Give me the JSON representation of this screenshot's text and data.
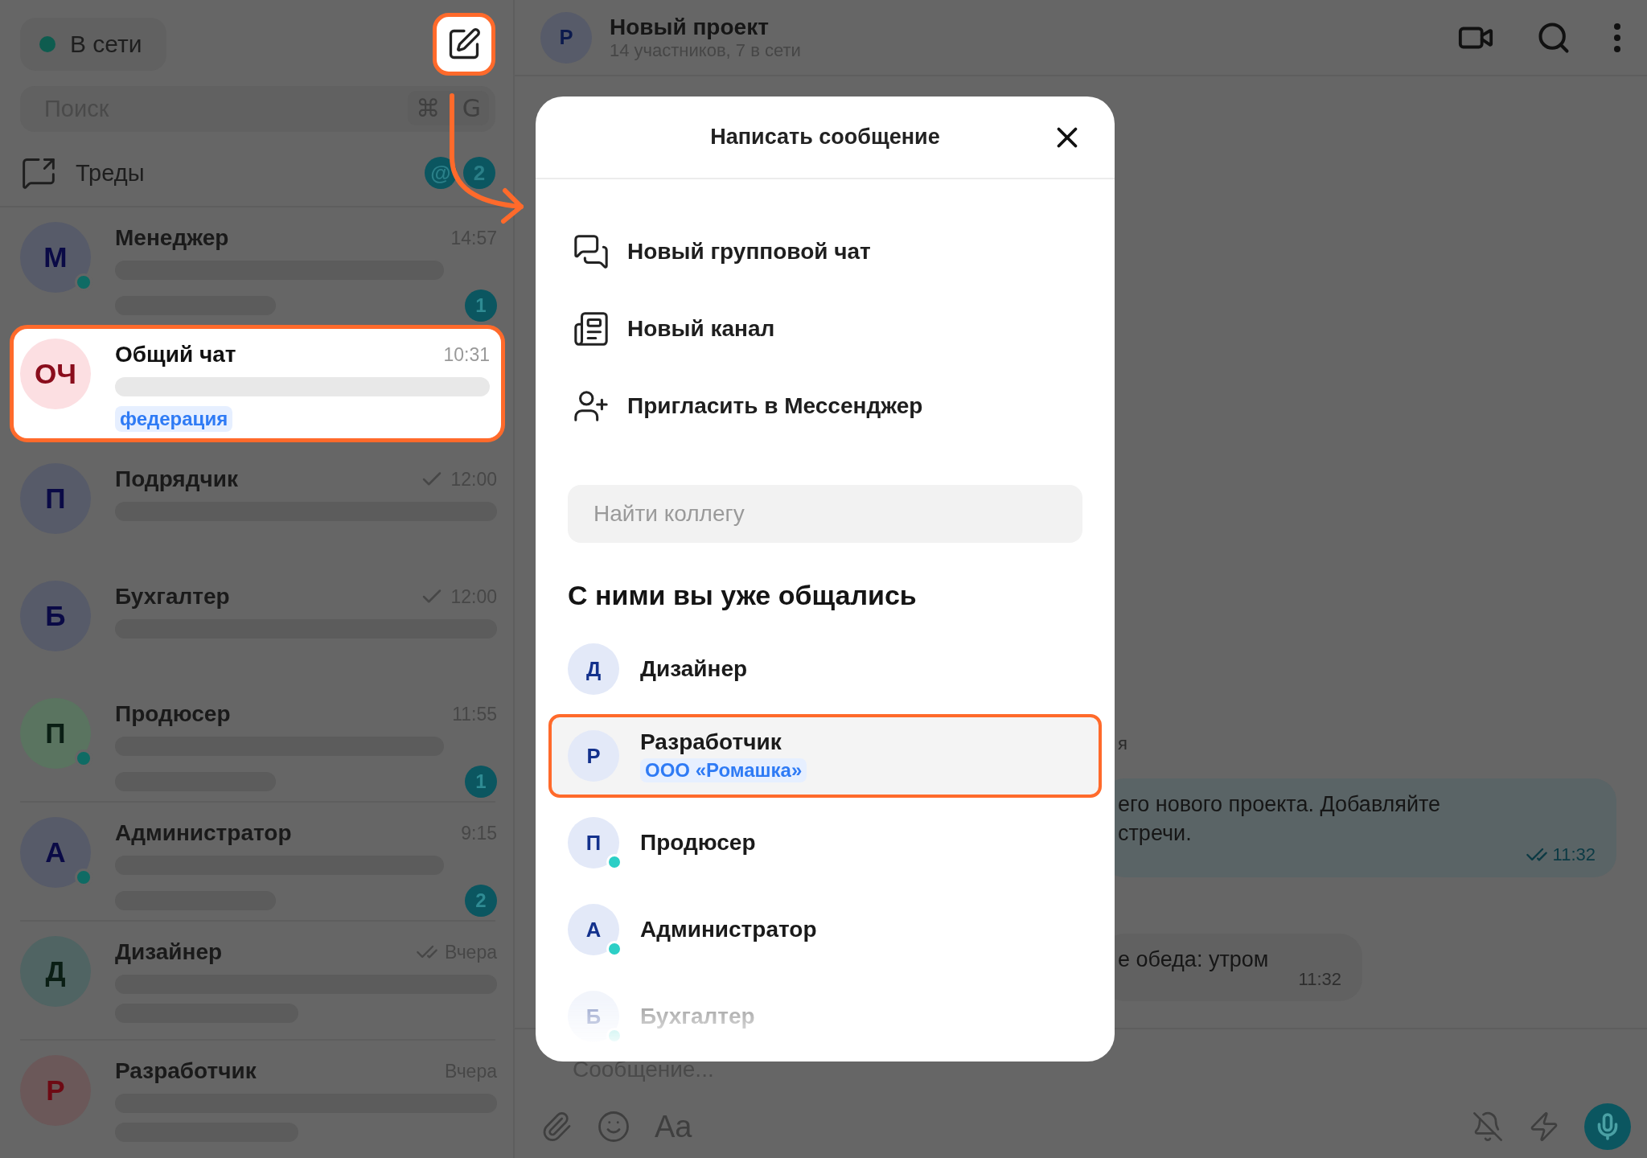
{
  "sidebar": {
    "status": {
      "label": "В сети",
      "color": "#0e5c4f"
    },
    "compose": {
      "highlighted": true
    },
    "search": {
      "placeholder": "Поиск",
      "keys": [
        "⌘",
        "G"
      ]
    },
    "threads": {
      "label": "Треды",
      "badges": [
        "@",
        "2"
      ]
    },
    "chats": [
      {
        "initials": "М",
        "color": "#575b69",
        "name": "Менеджер",
        "time": "14:57",
        "sent": false,
        "read": false,
        "online": true,
        "unread": "1",
        "long_preview": true,
        "highlighted": false
      },
      {
        "initials": "ОЧ",
        "color": "#fcdfe2",
        "name": "Общий чат",
        "time": "10:31",
        "sent": false,
        "read": false,
        "online": false,
        "long_preview": false,
        "tag": "федерация",
        "highlighted": true
      },
      {
        "initials": "П",
        "color": "#575b69",
        "name": "Подрядчик",
        "time": "12:00",
        "sent": true,
        "read": false,
        "online": false,
        "long_preview": false,
        "highlighted": false
      },
      {
        "initials": "Б",
        "color": "#575b69",
        "name": "Бухгалтер",
        "time": "12:00",
        "sent": true,
        "read": false,
        "online": false,
        "long_preview": false,
        "highlighted": false
      },
      {
        "initials": "П",
        "color": "#5a7460",
        "name": "Продюсер",
        "time": "11:55",
        "sent": false,
        "read": false,
        "online": true,
        "unread": "1",
        "long_preview": true,
        "highlighted": false
      },
      {
        "initials": "А",
        "color": "#575b69",
        "name": "Администратор",
        "time": "9:15",
        "sent": false,
        "read": false,
        "online": true,
        "unread": "2",
        "long_preview": true,
        "highlighted": false
      },
      {
        "initials": "Д",
        "color": "#506463",
        "name": "Дизайнер",
        "time": "Вчера",
        "sent": true,
        "read": true,
        "online": false,
        "long_preview": true,
        "highlighted": false
      },
      {
        "initials": "Р",
        "color": "#6b5859",
        "name": "Разработчик",
        "time": "Вчера",
        "sent": false,
        "read": false,
        "online": false,
        "long_preview": true,
        "highlighted": false
      }
    ]
  },
  "chat": {
    "avatar": "Р",
    "title": "Новый проект",
    "subtitle": "14 участников, 7 в сети",
    "day_label": "я",
    "messages": [
      {
        "lines": [
          "его нового проекта. Добавляйте",
          "стречи."
        ],
        "time": "11:32",
        "outgoing": true,
        "read": true
      },
      {
        "lines": [
          "е обеда: утром"
        ],
        "time": "11:32",
        "outgoing": false,
        "read": false
      }
    ],
    "composer": {
      "placeholder": "Сообщение...",
      "format": "Aa"
    }
  },
  "dialog": {
    "title": "Написать сообщение",
    "actions": [
      {
        "kind": "group-chat",
        "label": "Новый групповой чат"
      },
      {
        "kind": "channel",
        "label": "Новый канал"
      },
      {
        "kind": "invite",
        "label": "Пригласить в Мессенджер"
      }
    ],
    "search": {
      "placeholder": "Найти коллегу"
    },
    "section": "С ними вы уже общались",
    "contacts": [
      {
        "initials": "Д",
        "name": "Дизайнер",
        "online": false,
        "highlighted": false,
        "faded": false
      },
      {
        "initials": "Р",
        "name": "Разработчик",
        "tag": "ООО «Ромашка»",
        "online": false,
        "highlighted": true,
        "faded": false
      },
      {
        "initials": "П",
        "name": "Продюсер",
        "online": true,
        "highlighted": false,
        "faded": false
      },
      {
        "initials": "А",
        "name": "Администратор",
        "online": true,
        "highlighted": false,
        "faded": false
      },
      {
        "initials": "Б",
        "name": "Бухгалтер",
        "online": true,
        "highlighted": false,
        "faded": true
      }
    ]
  }
}
